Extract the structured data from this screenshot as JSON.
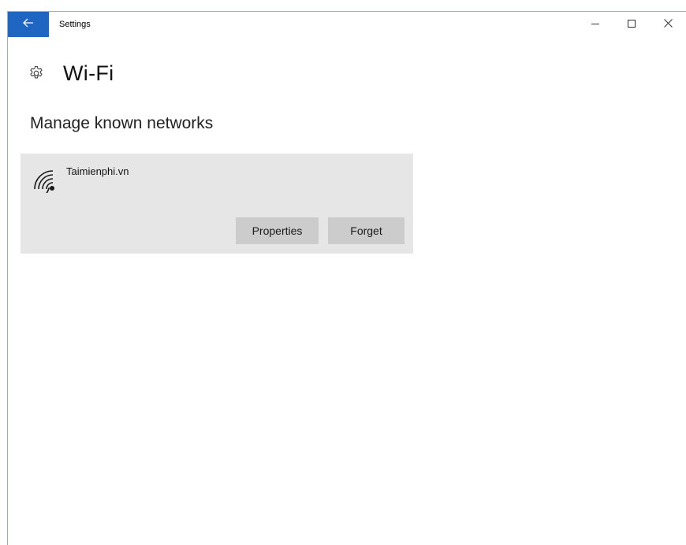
{
  "titlebar": {
    "app_title": "Settings",
    "back_icon": "arrow-left-icon",
    "accent_color": "#1f66c2",
    "minimize_icon": "minimize-icon",
    "maximize_icon": "maximize-icon",
    "close_icon": "close-icon"
  },
  "header": {
    "icon": "gear-icon",
    "title": "Wi-Fi"
  },
  "section": {
    "title": "Manage known networks"
  },
  "networks": [
    {
      "icon": "wifi-signal-icon",
      "name": "Taimienphi.vn",
      "properties_label": "Properties",
      "forget_label": "Forget"
    }
  ],
  "colors": {
    "card_background": "#e6e6e6",
    "button_background": "#cccccc"
  }
}
